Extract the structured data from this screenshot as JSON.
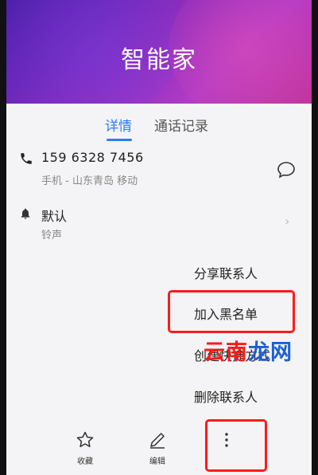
{
  "header": {
    "contact_name": "智能家"
  },
  "tabs": [
    {
      "label": "详情",
      "active": true
    },
    {
      "label": "通话记录",
      "active": false
    }
  ],
  "phone": {
    "number": "159 6328 7456",
    "subtitle": "手机 - 山东青岛 移动",
    "phone_icon": "phone-icon",
    "message_icon": "message-bubble-icon"
  },
  "ringtone": {
    "title": "默认",
    "subtitle": "铃声",
    "icon": "bell-icon"
  },
  "menu": {
    "items": [
      "分享联系人",
      "加入黑名单",
      "创建快捷方式",
      "删除联系人"
    ]
  },
  "bottom_bar": {
    "favorite": {
      "label": "收藏",
      "icon": "star-icon"
    },
    "edit": {
      "label": "编辑",
      "icon": "pencil-icon"
    },
    "more": {
      "icon": "more-vertical-icon"
    }
  },
  "watermark": {
    "part1": "云南",
    "part2": "龙网"
  },
  "colors": {
    "accent": "#2e7cf6",
    "highlight": "#ff1a1a",
    "header_start": "#4b1fa8",
    "header_end": "#c0329a"
  }
}
